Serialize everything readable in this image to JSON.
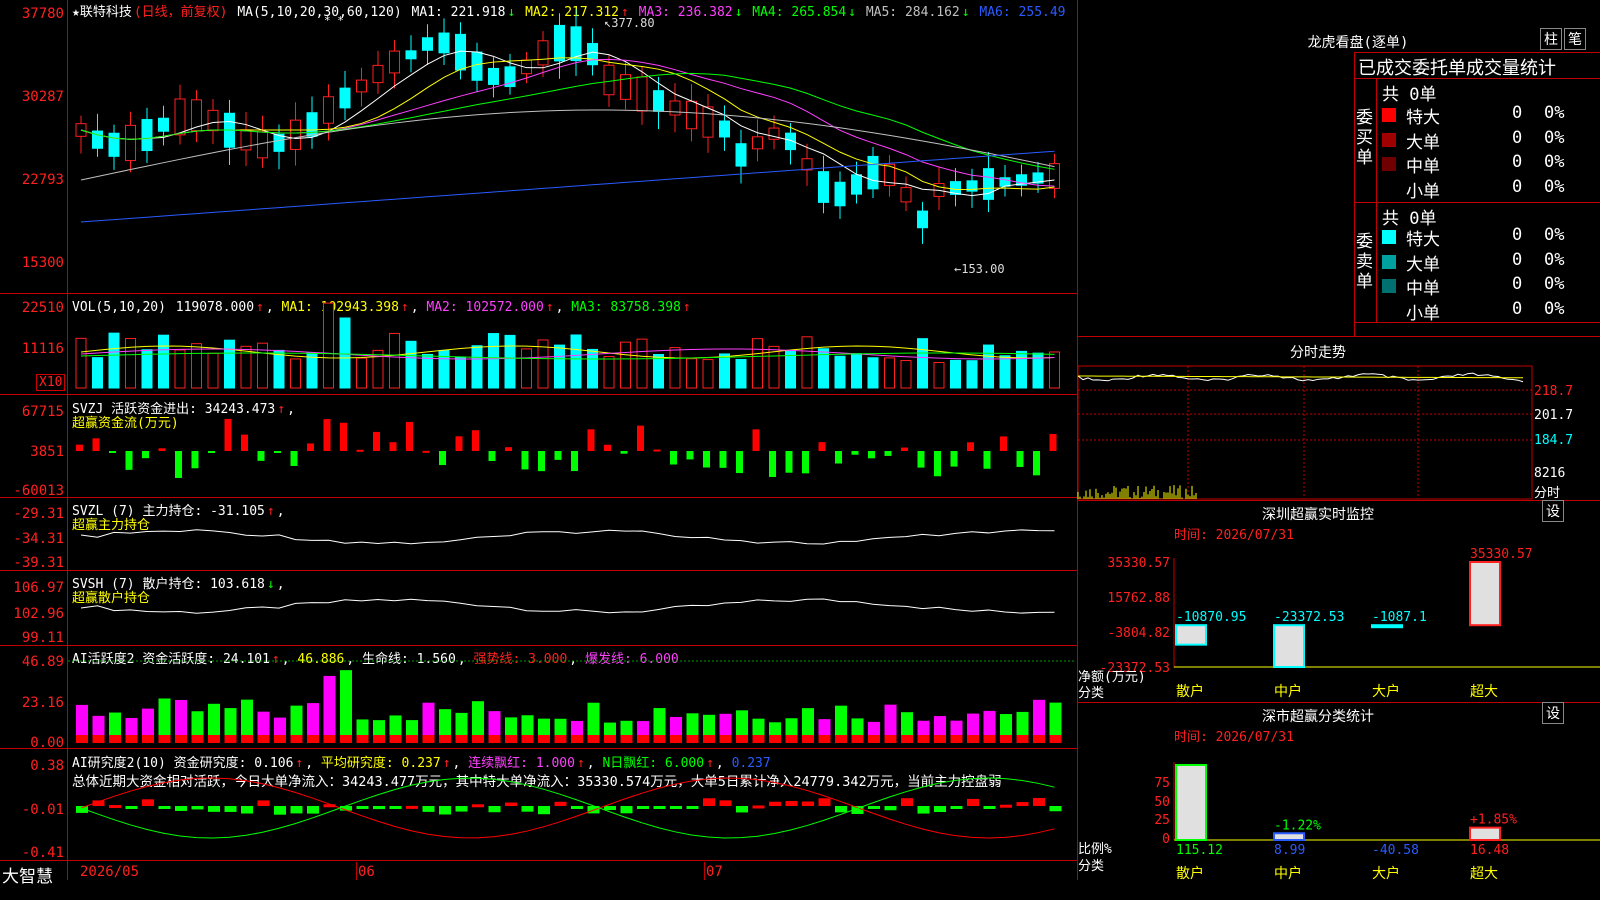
{
  "main": {
    "stock_label": "★联特科技",
    "mode": "(日线，前复权)",
    "ma_title": "MA(5,10,20,30,60,120)",
    "ma": [
      {
        "label": "MA1:",
        "value": "221.918",
        "arrow": "↓",
        "color": "#ffffff"
      },
      {
        "label": "MA2:",
        "value": "217.312",
        "arrow": "↑",
        "color": "#ffff00"
      },
      {
        "label": "MA3:",
        "value": "236.382",
        "arrow": "↓",
        "color": "#ff40ff"
      },
      {
        "label": "MA4:",
        "value": "265.854",
        "arrow": "↓",
        "color": "#00ff00"
      },
      {
        "label": "MA5:",
        "value": "284.162",
        "arrow": "↓",
        "color": "#c0c0c0"
      },
      {
        "label": "MA6:",
        "value": "255.49",
        "arrow": "",
        "color": "#2a5bff"
      }
    ],
    "price_ticks": [
      "37780",
      "30287",
      "22793",
      "15300"
    ],
    "high_marker": "377.80",
    "low_marker": "←153.00",
    "star_marks": "* *"
  },
  "vol": {
    "title": "VOL(5,10,20)",
    "value": "119078.000",
    "ma1": "MA1: 102943.398",
    "ma2": "MA2: 102572.000",
    "ma3": "MA3: 83758.398",
    "ticks": [
      "22510",
      "11116"
    ],
    "unit": "X10"
  },
  "svzj": {
    "title": "SVZJ  活跃资金进出: 34243.473",
    "subtitle": "超赢资金流(万元)",
    "ticks": [
      "67715",
      "3851",
      "-60013"
    ]
  },
  "svzl": {
    "title": "SVZL (7) 主力持仓: -31.105",
    "subtitle": "超赢主力持仓",
    "ticks": [
      "-29.31",
      "-34.31",
      "-39.31"
    ]
  },
  "svsh": {
    "title": "SVSH (7) 散户持仓: 103.618",
    "subtitle": "超赢散户持仓",
    "ticks": [
      "106.97",
      "102.96",
      "99.11"
    ]
  },
  "ai_active": {
    "title": "AI活跃度2 资金活跃度: 24.101",
    "v2": "46.886",
    "life": "生命线: 1.560",
    "strong": "强势线: 3.000",
    "burst": "爆发线: 6.000",
    "ticks": [
      "46.89",
      "23.16",
      "0.00"
    ]
  },
  "ai_research": {
    "title": "AI研究度2(10) 资金研究度: 0.106",
    "avg": "平均研究度: 0.237",
    "cont": "连续飘红: 1.000",
    "nday": "N日飘红: 6.000",
    "last": "0.237",
    "summary": "总体近期大资金相对活跃，今日大单净流入：34243.477万元，其中特大单净流入：35330.574万元，大单5日累计净入24779.342万元，当前主力控盘弱",
    "ticks": [
      "0.38",
      "-0.01",
      "-0.41"
    ]
  },
  "xaxis": {
    "brand": "大智慧",
    "labels": [
      "2026/05",
      "06",
      "07"
    ]
  },
  "lhb": {
    "title": "龙虎看盘(逐单)",
    "btn1": "柱",
    "btn2": "笔",
    "subtitle": "已成交委托单成交量统计",
    "buy_label": "委买单",
    "sell_label": "委卖单",
    "buy_total": "共 0单",
    "sell_total": "共 0单",
    "rows": [
      {
        "name": "特大",
        "count": "0",
        "pct": "0%"
      },
      {
        "name": "大单",
        "count": "0",
        "pct": "0%"
      },
      {
        "name": "中单",
        "count": "0",
        "pct": "0%"
      },
      {
        "name": "小单",
        "count": "0",
        "pct": "0%"
      }
    ],
    "buy_colors": [
      "#ff0000",
      "#a00000",
      "#700000",
      ""
    ],
    "sell_colors": [
      "#00ffff",
      "#00a0a0",
      "#007070",
      ""
    ]
  },
  "fenshi": {
    "title": "分时走势",
    "ticks": [
      "218.7",
      "201.7",
      "184.7",
      "8216"
    ],
    "unit": "分时"
  },
  "sz_monitor": {
    "title": "深圳超赢实时监控",
    "btn": "设",
    "time": "时间: 2026/07/31",
    "ticks": [
      "35330.57",
      "15762.88",
      "-3804.82",
      "-23372.53"
    ],
    "ylabel": "净额(万元)",
    "xlabel": "分类",
    "bars": [
      {
        "cat": "散户",
        "value": "-10870.95"
      },
      {
        "cat": "中户",
        "value": "-23372.53"
      },
      {
        "cat": "大户",
        "value": "-1087.1"
      },
      {
        "cat": "超大",
        "value": "35330.57"
      }
    ]
  },
  "sz_class": {
    "title": "深市超赢分类统计",
    "btn": "设",
    "time": "时间: 2026/07/31",
    "ticks": [
      "75",
      "50",
      "25",
      "0"
    ],
    "ylabel": "比例%",
    "xlabel": "分类",
    "bars": [
      {
        "cat": "散户",
        "value": "115.12",
        "pct": ""
      },
      {
        "cat": "中户",
        "value": "8.99",
        "pct": "-1.22%"
      },
      {
        "cat": "大户",
        "value": "-40.58",
        "pct": ""
      },
      {
        "cat": "超大",
        "value": "16.48",
        "pct": "+1.85%"
      }
    ]
  }
}
